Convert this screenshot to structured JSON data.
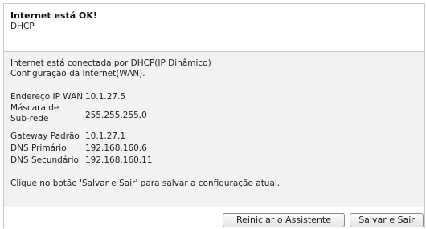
{
  "status": {
    "title": "Internet está OK!",
    "connection_type": "DHCP"
  },
  "info": {
    "connected_via": "Internet está conectada por DHCP(IP Dinâmico)",
    "config_heading": "Configuração da Internet(WAN).",
    "fields": [
      {
        "label": "Endereço IP WAN",
        "value": "10.1.27.5"
      },
      {
        "label": "Máscara de Sub-rede",
        "value": "255.255.255.0"
      },
      {
        "label": "Gateway Padrão",
        "value": "10.1.27.1"
      },
      {
        "label": "DNS Primário",
        "value": "192.168.160.6"
      },
      {
        "label": "DNS Secundário",
        "value": "192.168.160.11"
      }
    ],
    "instruction": "Clique no botão 'Salvar e Sair' para salvar a configuração atual."
  },
  "buttons": {
    "restart_wizard": "Reiniciar o Assistente",
    "save_exit": "Salvar e Sair"
  }
}
